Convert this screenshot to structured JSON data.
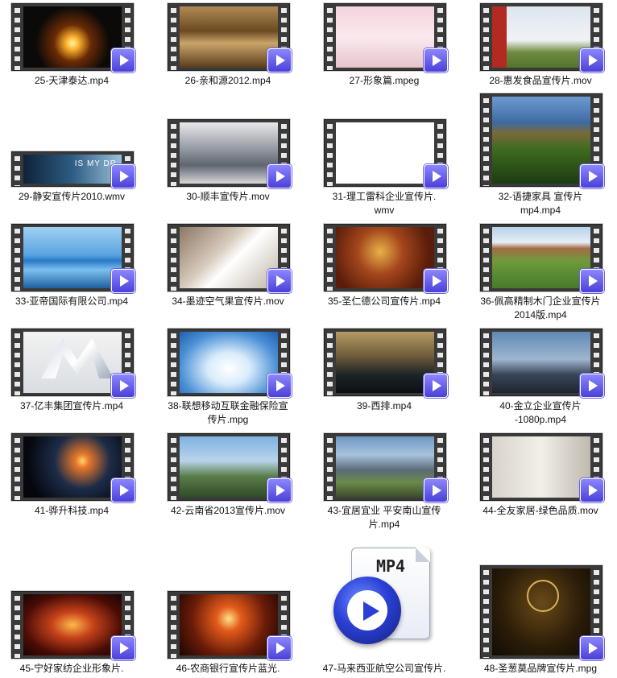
{
  "window": {
    "title": ""
  },
  "files": [
    {
      "name": "25-天津泰达.mp4",
      "line2": ""
    },
    {
      "name": "26-亲和源2012.mp4",
      "line2": ""
    },
    {
      "name": "27-形象篇.mpeg",
      "line2": ""
    },
    {
      "name": "28-惠发食品宣传片.mov",
      "line2": ""
    },
    {
      "name": "29-静安宣传片2010.wmv",
      "line2": "",
      "thumb_text": "IS MY DR"
    },
    {
      "name": "30-顺丰宣传片.mov",
      "line2": ""
    },
    {
      "name": "31-理工雷科企业宣传片.",
      "line2": "wmv"
    },
    {
      "name": "32-语捷家具 宣传片",
      "line2": "mp4.mp4"
    },
    {
      "name": "33-亚帝国际有限公司.mp4",
      "line2": ""
    },
    {
      "name": "34-墨迹空气果宣传片.mov",
      "line2": ""
    },
    {
      "name": "35-圣仁德公司宣传片.mp4",
      "line2": ""
    },
    {
      "name": "36-佩高精制木门企业宣传片",
      "line2": "2014版.mp4"
    },
    {
      "name": "37-亿丰集团宣传片.mp4",
      "line2": ""
    },
    {
      "name": "38-联想移动互联金融保险宣",
      "line2": "传片.mpg"
    },
    {
      "name": "39-西排.mp4",
      "line2": ""
    },
    {
      "name": "40-金立企业宣传片",
      "line2": "-1080p.mp4"
    },
    {
      "name": "41-骅升科技.mp4",
      "line2": ""
    },
    {
      "name": "42-云南省2013宣传片.mov",
      "line2": ""
    },
    {
      "name": "43-宜居宜业 平安南山宣传",
      "line2": "片.mp4"
    },
    {
      "name": "44-全友家居-绿色品质.mov",
      "line2": ""
    },
    {
      "name": "45-宁好家纺企业形象片.",
      "line2": ""
    },
    {
      "name": "46-农商银行宣传片蓝光.",
      "line2": ""
    },
    {
      "name": "47-马来西亚航空公司宣传片.",
      "line2": "",
      "icon_text": "MP4"
    },
    {
      "name": "48-圣葱莫品牌宣传片.mpg",
      "line2": ""
    }
  ],
  "colors": {
    "badge": "#5a52e6",
    "background": "#ffffff",
    "filmstrip": "#3a3a3a"
  }
}
